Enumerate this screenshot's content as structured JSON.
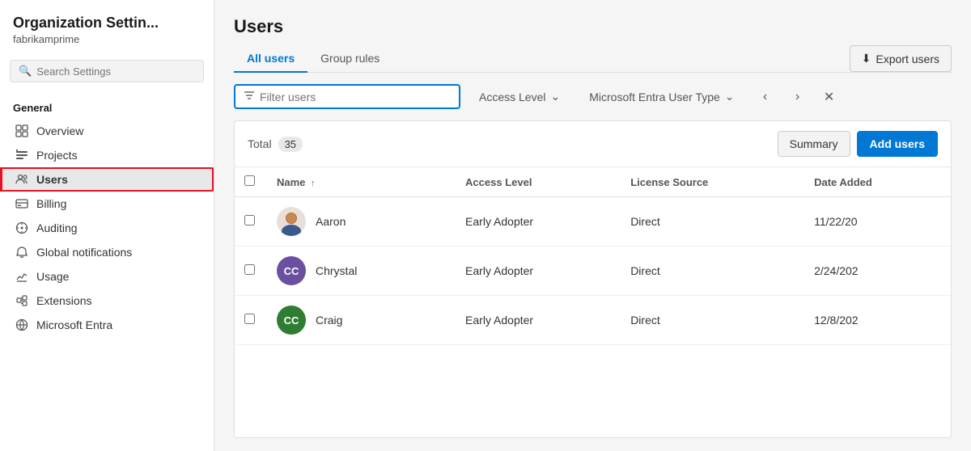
{
  "sidebar": {
    "title": "Organization Settin...",
    "subtitle": "fabrikamprime",
    "search_placeholder": "Search Settings",
    "section_label": "General",
    "items": [
      {
        "id": "overview",
        "label": "Overview",
        "icon": "grid-icon"
      },
      {
        "id": "projects",
        "label": "Projects",
        "icon": "projects-icon"
      },
      {
        "id": "users",
        "label": "Users",
        "icon": "users-icon",
        "active": true
      },
      {
        "id": "billing",
        "label": "Billing",
        "icon": "billing-icon"
      },
      {
        "id": "auditing",
        "label": "Auditing",
        "icon": "auditing-icon"
      },
      {
        "id": "global-notifications",
        "label": "Global notifications",
        "icon": "notification-icon"
      },
      {
        "id": "usage",
        "label": "Usage",
        "icon": "usage-icon"
      },
      {
        "id": "extensions",
        "label": "Extensions",
        "icon": "extensions-icon"
      },
      {
        "id": "microsoft-entra",
        "label": "Microsoft Entra",
        "icon": "entra-icon"
      }
    ]
  },
  "main": {
    "page_title": "Users",
    "tabs": [
      {
        "id": "all-users",
        "label": "All users",
        "active": true
      },
      {
        "id": "group-rules",
        "label": "Group rules",
        "active": false
      }
    ],
    "export_btn_label": "Export users",
    "filter": {
      "placeholder": "Filter users",
      "access_level_label": "Access Level",
      "user_type_label": "Microsoft Entra User Type"
    },
    "table": {
      "total_label": "Total",
      "total_count": "35",
      "summary_btn": "Summary",
      "add_users_btn": "Add users",
      "columns": [
        "Name",
        "Access Level",
        "License Source",
        "Date Added"
      ],
      "rows": [
        {
          "name": "Aaron",
          "access_level": "Early Adopter",
          "license_source": "Direct",
          "date_added": "11/22/20",
          "avatar_type": "image",
          "avatar_color": "",
          "initials": ""
        },
        {
          "name": "Chrystal",
          "access_level": "Early Adopter",
          "license_source": "Direct",
          "date_added": "2/24/202",
          "avatar_type": "initials",
          "avatar_color": "#6b4fa0",
          "initials": "CC"
        },
        {
          "name": "Craig",
          "access_level": "Early Adopter",
          "license_source": "Direct",
          "date_added": "12/8/202",
          "avatar_type": "initials",
          "avatar_color": "#2e7d32",
          "initials": "CC"
        }
      ]
    }
  }
}
